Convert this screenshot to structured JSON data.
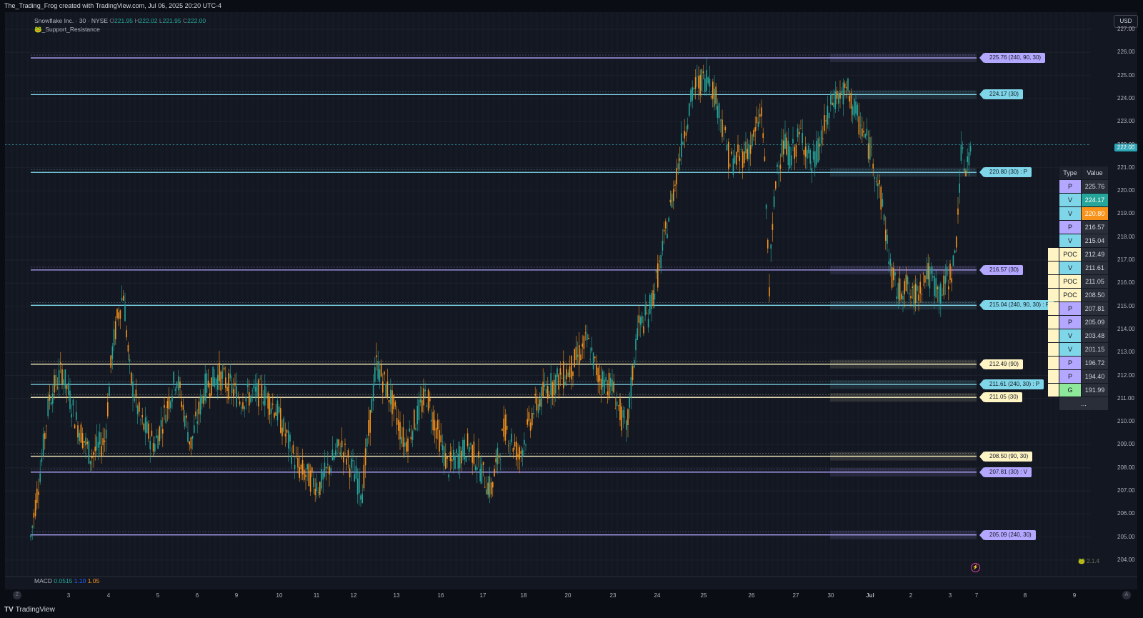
{
  "header": {
    "title": "The_Trading_Frog created with TradingView.com, Jul 06, 2025 20:20 UTC-4"
  },
  "legend": {
    "symbol": "Snowflake Inc. · 30 · NYSE",
    "o_label": "O",
    "o": "221.95",
    "h_label": "H",
    "h": "222.02",
    "l_label": "L",
    "l": "221.95",
    "c_label": "C",
    "c": "222.00",
    "indicator": "_Support_Resistance",
    "macd_label": "MACD",
    "macd_values": [
      "0.0515",
      "1.10",
      "1.05"
    ]
  },
  "currency": "USD",
  "current_price": "222.00",
  "y_axis": [
    "227.00",
    "226.00",
    "225.00",
    "224.00",
    "223.00",
    "222.00",
    "221.00",
    "220.00",
    "219.00",
    "218.00",
    "217.00",
    "216.00",
    "215.00",
    "214.00",
    "213.00",
    "212.00",
    "211.00",
    "210.00",
    "209.00",
    "208.00",
    "207.00",
    "206.00",
    "205.00",
    "204.00"
  ],
  "x_axis": [
    "3",
    "4",
    "5",
    "6",
    "9",
    "10",
    "11",
    "12",
    "13",
    "16",
    "17",
    "18",
    "20",
    "23",
    "24",
    "25",
    "26",
    "27",
    "30",
    "Jul",
    "2",
    "3",
    "7",
    "8",
    "9"
  ],
  "levels": [
    {
      "label": "225.76 (240, 90, 30)",
      "kind": "p"
    },
    {
      "label": "224.17 (30)",
      "kind": "v"
    },
    {
      "label": "220.80 (30) : P",
      "kind": "v"
    },
    {
      "label": "216.57 (30)",
      "kind": "p"
    },
    {
      "label": "215.04 (240, 90, 30) : P",
      "kind": "v"
    },
    {
      "label": "212.49 (90)",
      "kind": "poc"
    },
    {
      "label": "211.61 (240, 30) : P",
      "kind": "v"
    },
    {
      "label": "211.05 (30)",
      "kind": "poc"
    },
    {
      "label": "208.50 (90, 30)",
      "kind": "poc"
    },
    {
      "label": "207.81 (30) : V",
      "kind": "p"
    },
    {
      "label": "205.09 (240, 30)",
      "kind": "p"
    }
  ],
  "table": {
    "headers": [
      "Type",
      "Value"
    ],
    "rows": [
      {
        "type": "P",
        "value": "225.76"
      },
      {
        "type": "V",
        "value": "224.17"
      },
      {
        "type": "V",
        "value": "220.80"
      },
      {
        "type": "P",
        "value": "216.57"
      },
      {
        "type": "V",
        "value": "215.04"
      },
      {
        "type": "POC",
        "value": "212.49"
      },
      {
        "type": "V",
        "value": "211.61"
      },
      {
        "type": "POC",
        "value": "211.05"
      },
      {
        "type": "POC",
        "value": "208.50"
      },
      {
        "type": "P",
        "value": "207.81"
      },
      {
        "type": "P",
        "value": "205.09"
      },
      {
        "type": "V",
        "value": "203.48"
      },
      {
        "type": "V",
        "value": "201.15"
      },
      {
        "type": "P",
        "value": "196.72"
      },
      {
        "type": "P",
        "value": "194.40"
      },
      {
        "type": "G",
        "value": "191.99"
      }
    ],
    "more": "..."
  },
  "version_badge": "2.1.4",
  "brand": "TradingView",
  "colors": {
    "up": "#26a69a",
    "down": "#f7931a",
    "p": "#b4a7ff",
    "v": "#7fd6e8",
    "poc": "#fff5c4"
  }
}
